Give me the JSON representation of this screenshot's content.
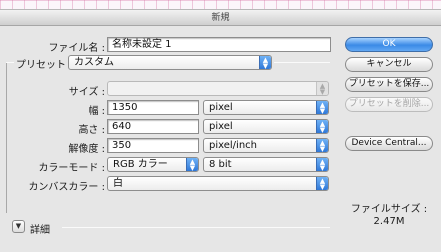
{
  "dialog": {
    "title": "新規"
  },
  "form": {
    "filename": {
      "label": "ファイル名 :",
      "value": "名称未設定 1"
    },
    "preset": {
      "label": "プリセット :",
      "value": "カスタム"
    },
    "size": {
      "label": "サイズ :",
      "value": ""
    },
    "width": {
      "label": "幅 :",
      "value": "1350",
      "unit": "pixel"
    },
    "height": {
      "label": "高さ :",
      "value": "640",
      "unit": "pixel"
    },
    "resolution": {
      "label": "解像度 :",
      "value": "350",
      "unit": "pixel/inch"
    },
    "color_mode": {
      "label": "カラーモード :",
      "mode": "RGB カラー",
      "depth": "8 bit"
    },
    "canvas_color": {
      "label": "カンバスカラー :",
      "value": "白"
    },
    "advanced": {
      "label": "詳細"
    }
  },
  "buttons": {
    "ok": "OK",
    "cancel": "キャンセル",
    "save_preset": "プリセットを保存...",
    "delete_preset": "プリセットを削除...",
    "device_central": "Device Central..."
  },
  "file_size": {
    "label": "ファイルサイズ :",
    "value": "2.47M"
  },
  "colors": {
    "accent": "#3b8ae6",
    "grid": "#d66ea0",
    "dialog_bg": "#e6e6e6"
  }
}
